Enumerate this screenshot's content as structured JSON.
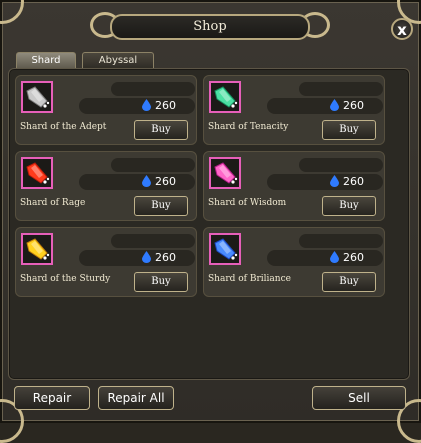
{
  "window": {
    "title": "Shop",
    "close_label": "x"
  },
  "tabs": [
    {
      "label": "Shard",
      "active": true
    },
    {
      "label": "Abyssal",
      "active": false
    }
  ],
  "currency_icon": "blue-drop-icon",
  "items": [
    {
      "name": "Shard of the Adept",
      "price": "260",
      "buy_label": "Buy",
      "color": "#c9c9c9",
      "accent": "#7c7c7c"
    },
    {
      "name": "Shard of Tenacity",
      "price": "260",
      "buy_label": "Buy",
      "color": "#4be0a3",
      "accent": "#16915f"
    },
    {
      "name": "Shard of Rage",
      "price": "260",
      "buy_label": "Buy",
      "color": "#ff3b1c",
      "accent": "#b81a0a"
    },
    {
      "name": "Shard of Wisdom",
      "price": "260",
      "buy_label": "Buy",
      "color": "#ff66c9",
      "accent": "#b11f87"
    },
    {
      "name": "Shard of the Sturdy",
      "price": "260",
      "buy_label": "Buy",
      "color": "#ffd11f",
      "accent": "#c07c0b"
    },
    {
      "name": "Shard of Briliance",
      "price": "260",
      "buy_label": "Buy",
      "color": "#4a8cff",
      "accent": "#1d47c2"
    }
  ],
  "footer": {
    "repair_label": "Repair",
    "repair_all_label": "Repair All",
    "sell_label": "Sell"
  }
}
